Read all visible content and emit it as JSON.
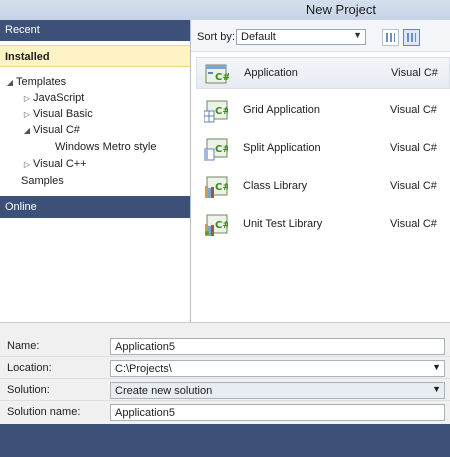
{
  "window": {
    "title": "New Project"
  },
  "sidebar": {
    "recent": "Recent",
    "installed": "Installed",
    "online": "Online",
    "tree": {
      "templates": "Templates",
      "javascript": "JavaScript",
      "visual_basic": "Visual Basic",
      "visual_csharp": "Visual C#",
      "windows_metro": "Windows Metro style",
      "visual_cpp": "Visual C++",
      "samples": "Samples"
    }
  },
  "sort": {
    "label": "Sort by:",
    "value": "Default"
  },
  "templates": [
    {
      "name": "Application",
      "lang": "Visual C#",
      "icon": "csharp-app-icon",
      "selected": true
    },
    {
      "name": "Grid Application",
      "lang": "Visual C#",
      "icon": "csharp-grid-icon"
    },
    {
      "name": "Split Application",
      "lang": "Visual C#",
      "icon": "csharp-split-icon"
    },
    {
      "name": "Class Library",
      "lang": "Visual C#",
      "icon": "csharp-class-library-icon"
    },
    {
      "name": "Unit Test Library",
      "lang": "Visual C#",
      "icon": "csharp-unit-test-icon"
    }
  ],
  "form": {
    "name_label": "Name:",
    "name_value": "Application5",
    "location_label": "Location:",
    "location_value": "C:\\Projects\\",
    "solution_label": "Solution:",
    "solution_value": "Create new solution",
    "solution_name_label": "Solution name:",
    "solution_name_value": "Application5"
  },
  "colors": {
    "header": "#3c5078",
    "installed_bg": "#fdf3c4",
    "csharp_green": "#5aa02c"
  }
}
